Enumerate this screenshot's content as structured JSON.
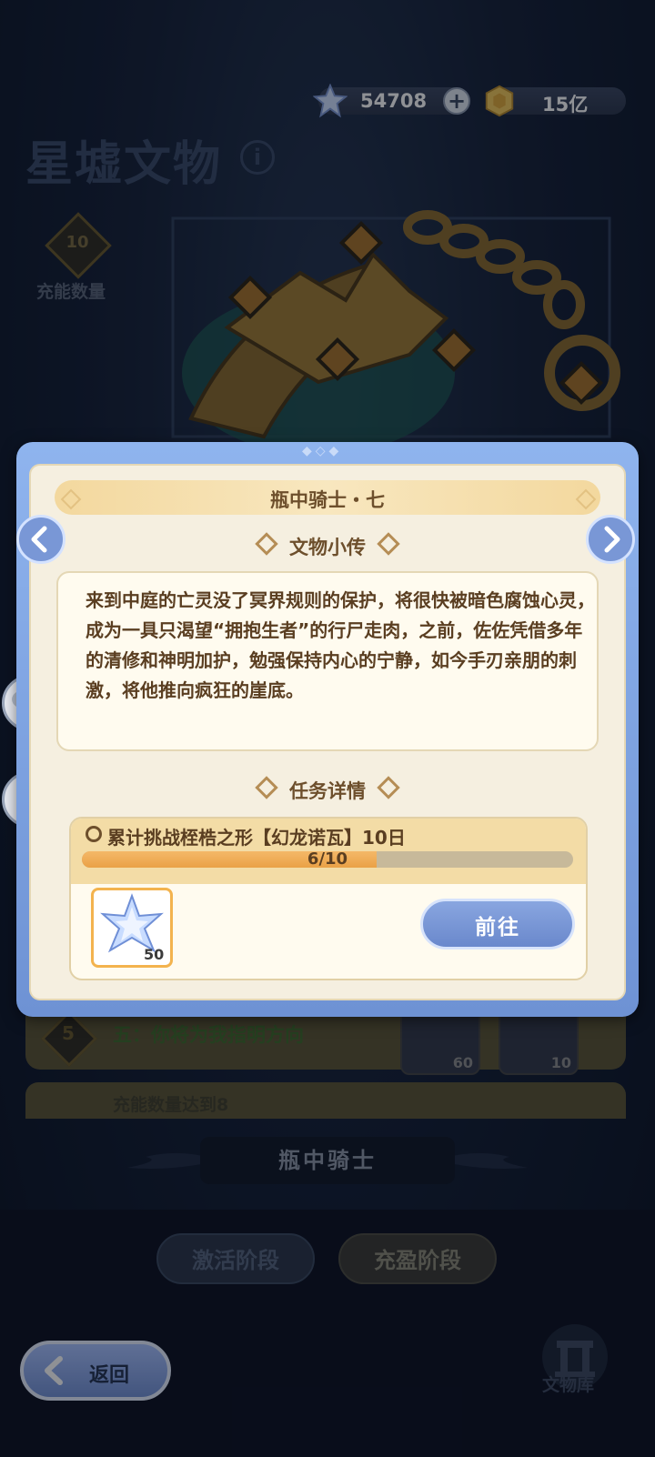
{
  "header": {
    "title": "星墟文物",
    "stardust_amount": "54708",
    "coin_amount": "15亿",
    "charge_count": "10",
    "charge_label": "充能数量"
  },
  "background_list": {
    "row_index": "5",
    "row_text": "五：你将为我指明方向",
    "row2_text": "充能数量达到8",
    "reward_qty_1": "60",
    "reward_qty_2": "10"
  },
  "artifact_name": "瓶中骑士",
  "stages": {
    "active": "激活阶段",
    "other": "充盈阶段"
  },
  "footer": {
    "back_label": "返回",
    "library_label": "文物库"
  },
  "modal": {
    "title": "瓶中骑士・七",
    "story_heading": "文物小传",
    "story_text": "来到中庭的亡灵没了冥界规则的保护，将很快被暗色腐蚀心灵，成为一具只渴望“拥抱生者”的行尸走肉，之前，佐佐凭借多年的清修和神明加护，勉强保持内心的宁静，如今手刃亲朋的刺激，将他推向疯狂的崖底。",
    "task_heading": "任务详情",
    "task_text": "累计挑战桎梏之形【幻龙诺瓦】10日",
    "progress_text": "6/10",
    "progress_current": 6,
    "progress_total": 10,
    "reward_qty": "50",
    "go_label": "前往"
  },
  "colors": {
    "modal_frame": "#7997d6",
    "progress_fill": "#eaa146",
    "panel": "#f5efe0"
  }
}
